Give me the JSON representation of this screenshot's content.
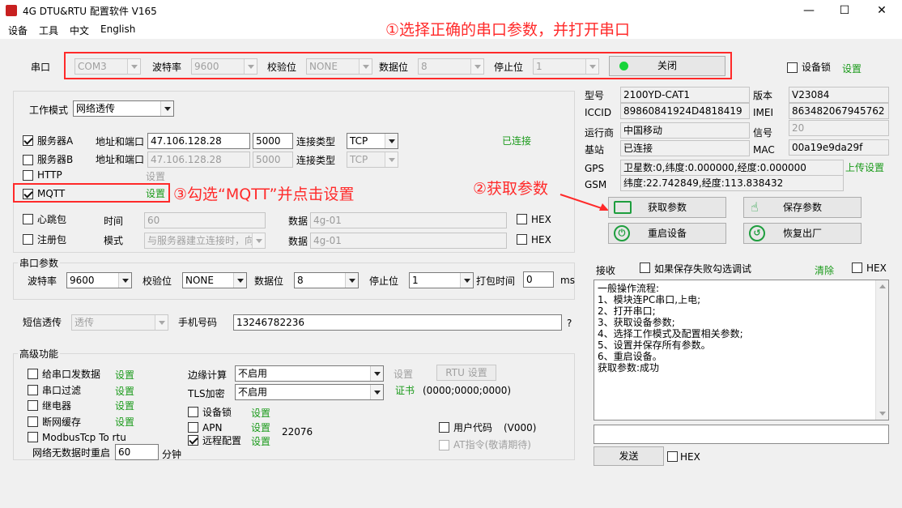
{
  "window": {
    "title": "4G DTU&RTU 配置软件  V165",
    "min": "—",
    "max": "☐",
    "close": "✕"
  },
  "menu": [
    "设备",
    "工具",
    "中文",
    "English"
  ],
  "annotations": {
    "a1": "①选择正确的串口参数，并打开串口",
    "a2": "②获取参数",
    "a3": "③勾选“MQTT”并点击设置"
  },
  "serial_top": {
    "port_label": "串口",
    "port": "COM3",
    "baud_label": "波特率",
    "baud": "9600",
    "parity_label": "校验位",
    "parity": "NONE",
    "databits_label": "数据位",
    "databits": "8",
    "stopbits_label": "停止位",
    "stopbits": "1",
    "close_button": "关闭",
    "lock_label": "设备锁",
    "settings_link": "设置"
  },
  "work": {
    "mode_label": "工作模式",
    "mode": "网络透传",
    "server_a": "服务器A",
    "server_b": "服务器B",
    "http": "HTTP",
    "mqtt": "MQTT",
    "addr_label": "地址和端口",
    "server_a_host": "47.106.128.28",
    "server_a_port": "5000",
    "server_b_host": "47.106.128.28",
    "server_b_port": "5000",
    "conn_type_label": "连接类型",
    "conn_a": "TCP",
    "conn_b": "TCP",
    "connected": "已连接",
    "http_settings": "设置",
    "mqtt_settings": "设置",
    "heartbeat": "心跳包",
    "time_label": "时间",
    "heartbeat_time": "60",
    "data_label": "数据",
    "heartbeat_data": "4g-01",
    "hex": "HEX",
    "register": "注册包",
    "mode2_label": "模式",
    "register_mode": "与服务器建立连接时，向",
    "register_data": "4g-01"
  },
  "serial_params": {
    "title": "串口参数",
    "baud_label": "波特率",
    "baud": "9600",
    "parity_label": "校验位",
    "parity": "NONE",
    "databits_label": "数据位",
    "databits": "8",
    "stopbits_label": "停止位",
    "stopbits": "1",
    "pack_label": "打包时间",
    "pack_time": "0",
    "unit": "ms"
  },
  "sms": {
    "label": "短信透传",
    "mode": "透传",
    "phone_label": "手机号码",
    "phone": "13246782236",
    "q": "?"
  },
  "advanced": {
    "title": "高级功能",
    "send_to_serial": "给串口发数据",
    "serial_filter": "串口过滤",
    "relay": "继电器",
    "offline_cache": "断网缓存",
    "modbus": "ModbusTcp To rtu",
    "settings": "设置",
    "no_data_restart": "网络无数据时重启",
    "restart_minutes": "60",
    "minutes": "分钟",
    "edge_label": "边缘计算",
    "edge": "不启用",
    "edge_settings": "设置",
    "rtu_settings": "RTU 设置",
    "tls_label": "TLS加密",
    "tls": "不启用",
    "cert": "证书",
    "cert_value": "(0000;0000;0000)",
    "dev_lock": "设备锁",
    "apn": "APN",
    "remote": "远程配置",
    "remote_port": "22076",
    "user_code": "用户代码",
    "user_code_value": "(V000)",
    "at_cmd": "AT指令(敬请期待)"
  },
  "info": {
    "model_label": "型号",
    "model": "2100YD-CAT1",
    "version_label": "版本",
    "version": "V23084",
    "iccid_label": "ICCID",
    "iccid": "89860841924D4818419",
    "imei_label": "IMEI",
    "imei": "863482067945762",
    "operator_label": "运行商",
    "operator": "中国移动",
    "signal_label": "信号",
    "signal": "20",
    "station_label": "基站",
    "station": "已连接",
    "mac_label": "MAC",
    "mac": "00a19e9da29f",
    "gps_label": "GPS",
    "gps": "卫星数:0,纬度:0.000000,经度:0.000000",
    "upload_settings": "上传设置",
    "gsm_label": "GSM",
    "gsm": "纬度:22.742849,经度:113.838432"
  },
  "actions": {
    "get": "获取参数",
    "save": "保存参数",
    "restart": "重启设备",
    "factory": "恢复出厂"
  },
  "receive": {
    "label": "接收",
    "save_failed": "如果保存失败勾选调试",
    "clear": "清除",
    "hex": "HEX",
    "log": "一般操作流程:\n1、模块连PC串口,上电;\n2、打开串口;\n3、获取设备参数;\n4、选择工作模式及配置相关参数;\n5、设置并保存所有参数。\n6、重启设备。\n获取参数:成功",
    "send": "发送",
    "send_hex": "HEX"
  }
}
